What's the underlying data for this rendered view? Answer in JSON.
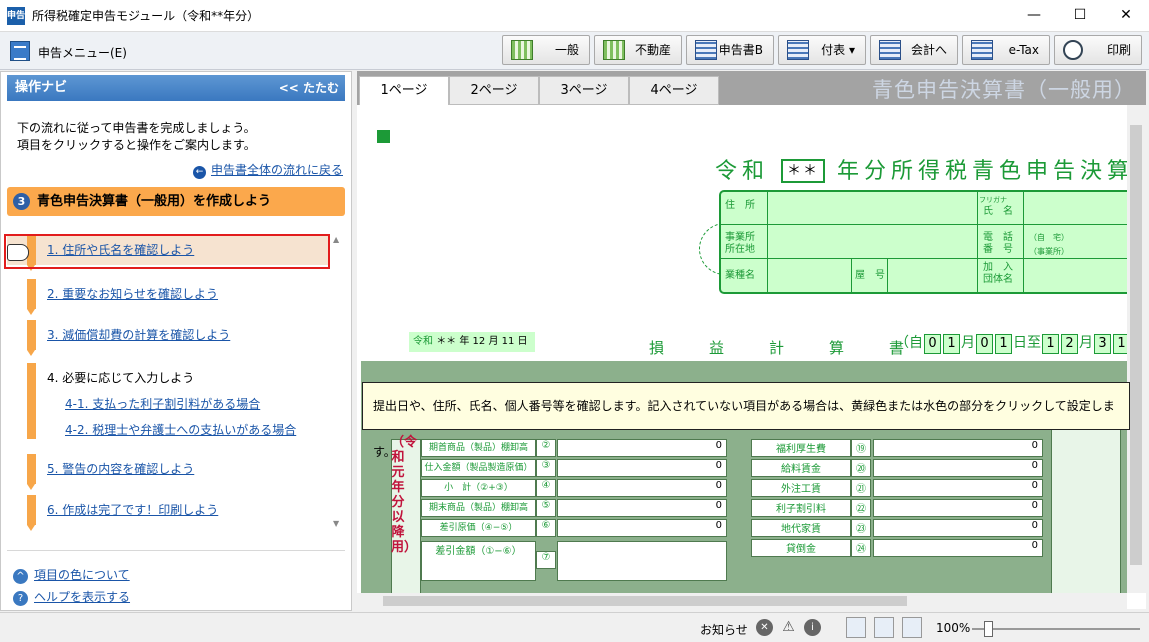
{
  "window": {
    "app_icon": "申告",
    "title": "所得税確定申告モジュール（令和**年分）",
    "minimize": "—",
    "maximize": "☐",
    "close": "✕"
  },
  "menu": {
    "label": "申告メニュー(E)"
  },
  "toolbar": [
    {
      "label": "一般",
      "icon": "ledger-icon"
    },
    {
      "label": "不動産",
      "icon": "ledger-icon"
    },
    {
      "label": "申告書B",
      "icon": "form-icon"
    },
    {
      "label": "付表 ▾",
      "icon": "form-icon"
    },
    {
      "label": "会計へ",
      "icon": "transfer-icon"
    },
    {
      "label": "e-Tax",
      "icon": "etax-icon"
    },
    {
      "label": "印刷",
      "icon": "magnifier-icon"
    }
  ],
  "nav": {
    "title": "操作ナビ",
    "collapse": "<< たたむ",
    "intro_line1": "下の流れに従って申告書を完成しましょう。",
    "intro_line2": "項目をクリックすると操作をご案内します。",
    "back_icon": "←",
    "back_link": "申告書全体の流れに戻る",
    "step_number": "3",
    "step_title": "青色申告決算書（一般用）を作成しよう",
    "steps": [
      "1. 住所や氏名を確認しよう",
      "2. 重要なお知らせを確認しよう",
      "3. 減価償却費の計算を確認しよう",
      "4. 必要に応じて入力しよう",
      "5. 警告の内容を確認しよう",
      "6. 作成は完了です！印刷しよう"
    ],
    "substeps": [
      "4-1. 支払った利子割引料がある場合",
      "4-2. 税理士や弁護士への支払いがある場合"
    ],
    "footer_links": [
      {
        "icon": "^",
        "label": "項目の色について"
      },
      {
        "icon": "?",
        "label": "ヘルプを表示する"
      }
    ]
  },
  "tabs": [
    "1ページ",
    "2ページ",
    "3ページ",
    "4ページ"
  ],
  "tab_title": "青色申告決算書（一般用）",
  "form": {
    "title_pre": "令和",
    "title_year": "＊＊",
    "title_post": "年分所得税青色申告決算書",
    "labels": {
      "address": "住　所",
      "furigana": "フリガナ",
      "name": "氏　名",
      "office": "事業所\n所在地",
      "phone": "電　話\n番　号",
      "phone_home": "（自　宅）",
      "phone_office": "（事業所）",
      "business": "業種名",
      "shop": "屋　号",
      "org": "加　入\n団体名"
    },
    "date_label": "令和",
    "date_value": "＊＊ 年 12 月 11 日",
    "pl_title": "損益計算書",
    "period_from": "（自",
    "period_digits_from": [
      "0",
      "1",
      "月",
      "0",
      "1",
      "日至"
    ],
    "period_digits_to": [
      "1",
      "2",
      "月",
      "3",
      "1"
    ],
    "vertical_text": "（令和元年分以降用）",
    "ledger_left": [
      "期首商品（製品）棚卸高",
      "仕入金額（製品製造原価）",
      "小　計（②+③）",
      "期末商品（製品）棚卸高",
      "差引原価（④−⑤）",
      "差引金額（①−⑥）"
    ],
    "ledger_left_nums": [
      "②",
      "③",
      "④",
      "⑤",
      "⑥",
      "⑦"
    ],
    "ledger_right": [
      "福利厚生費",
      "給料賃金",
      "外注工賃",
      "利子割引料",
      "地代家賃",
      "貸倒金"
    ],
    "ledger_right_nums": [
      "⑲",
      "⑳",
      "㉑",
      "㉒",
      "㉓",
      "㉔"
    ],
    "zero": "0"
  },
  "tooltip": "提出日や、住所、氏名、個人番号等を確認します。記入されていない項目がある場合は、黄緑色または水色の部分をクリックして設定します。",
  "status": {
    "notice": "お知らせ",
    "zoom": "100%"
  }
}
